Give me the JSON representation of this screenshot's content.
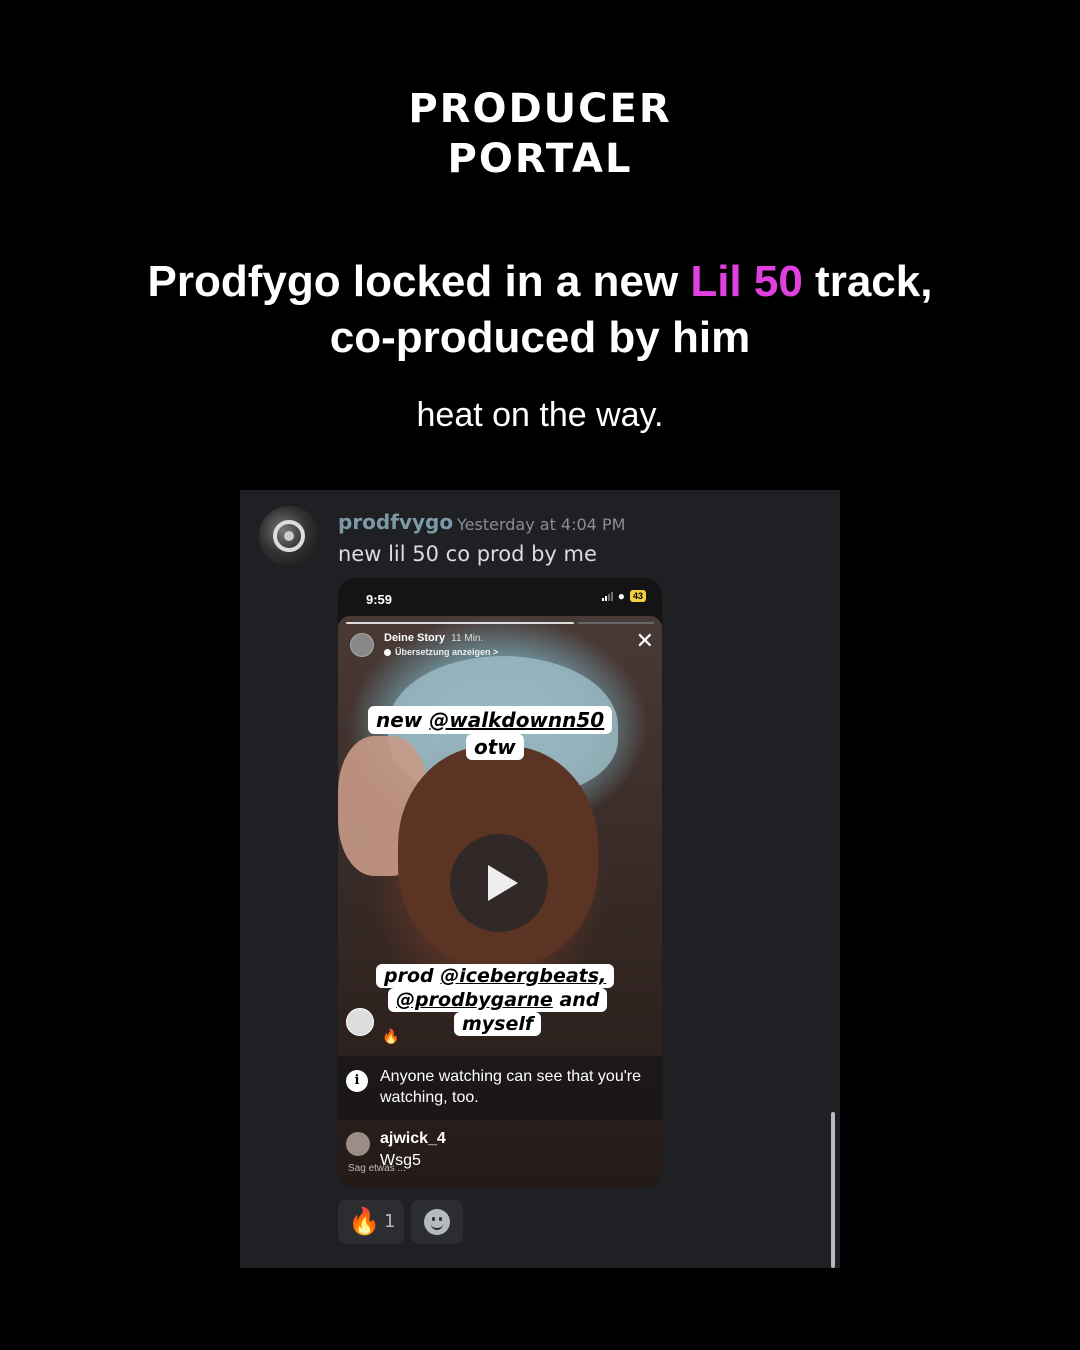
{
  "brand": {
    "line1": "PRODUCER",
    "line2": "PORTAL"
  },
  "headline": {
    "part1": "Prodfygo locked in a new ",
    "highlight": "Lil 50",
    "part2": " track, co-produced by him",
    "highlight_color": "#e040e0"
  },
  "subline": "heat on the way.",
  "message": {
    "username": "prodfvygo",
    "timestamp": "Yesterday at 4:04 PM",
    "text": "new lil 50 co prod by me"
  },
  "phone": {
    "status_time": "9:59",
    "battery": "43",
    "story": {
      "user": "Deine Story",
      "age": "11 Min.",
      "translate": "Übersetzung anzeigen >",
      "sticker_top_prefix": "new ",
      "sticker_top_handle": "@walkdownn50",
      "sticker_top_line2": "otw",
      "sticker_bottom_prefix": "prod ",
      "sticker_bottom_handle1": "@icebergbeats,",
      "sticker_bottom_handle2": "@prodbygarne",
      "sticker_bottom_and": " and",
      "sticker_bottom_line3": "myself",
      "notice": "Anyone watching can see that you're watching, too.",
      "comment_user": "ajwick_4",
      "comment_text": "Wsg5",
      "say_something": "Sag etwas ..."
    }
  },
  "reactions": {
    "fire_count": "1"
  },
  "icons": [
    "close-icon",
    "play-icon",
    "info-icon",
    "fire-icon",
    "smiley-icon",
    "wifi-icon",
    "signal-icon"
  ]
}
